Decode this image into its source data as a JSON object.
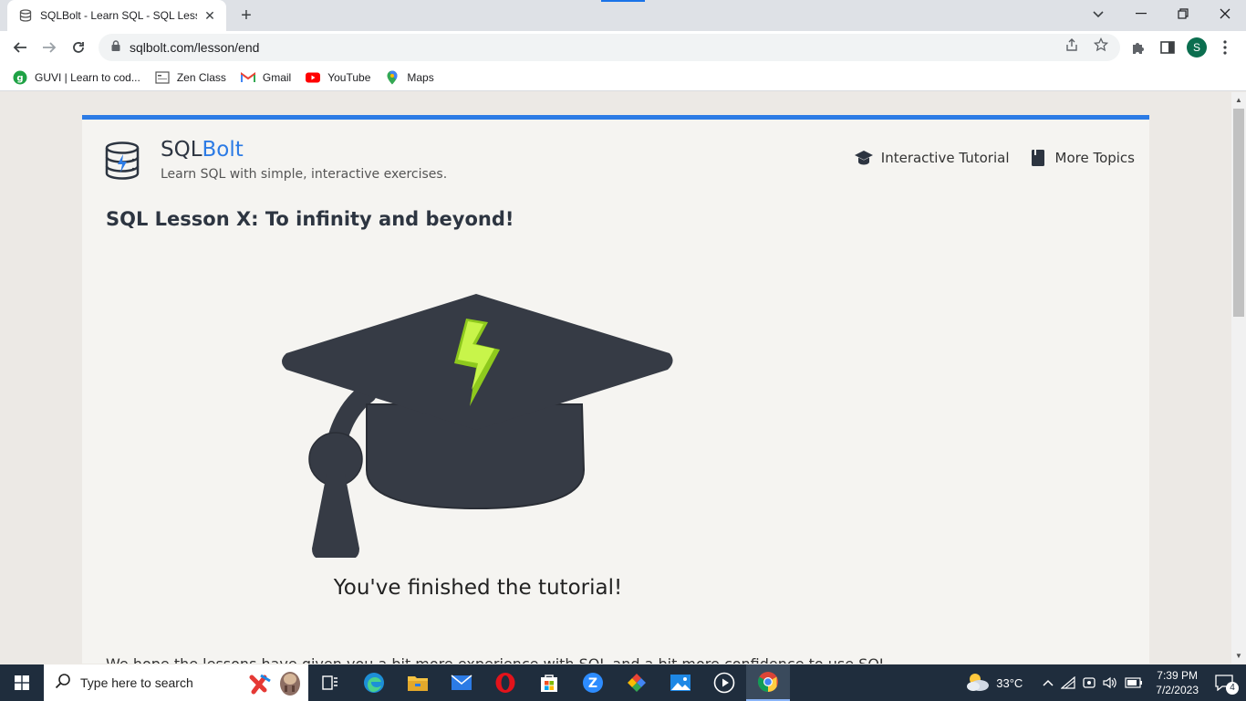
{
  "browser": {
    "tab_title": "SQLBolt - Learn SQL - SQL Lesson X: To infinity and beyond!",
    "tab_title_visible": "SQLBolt - Learn SQL - SQL Lesso",
    "url": "sqlbolt.com/lesson/end",
    "profile_initial": "S",
    "bookmarks": [
      {
        "label": "GUVI | Learn to cod...",
        "icon": "guvi-icon"
      },
      {
        "label": "Zen Class",
        "icon": "zen-class-icon"
      },
      {
        "label": "Gmail",
        "icon": "gmail-icon"
      },
      {
        "label": "YouTube",
        "icon": "youtube-icon"
      },
      {
        "label": "Maps",
        "icon": "maps-icon"
      }
    ]
  },
  "site": {
    "brand_sql": "SQL",
    "brand_bolt": "Bolt",
    "tagline": "Learn SQL with simple, interactive exercises.",
    "nav": [
      {
        "label": "Interactive Tutorial",
        "icon": "graduation-cap-icon"
      },
      {
        "label": "More Topics",
        "icon": "book-icon"
      }
    ],
    "accent_color": "#2c7be5"
  },
  "lesson": {
    "title": "SQL Lesson X: To infinity and beyond!",
    "finished_text": "You've finished the tutorial!",
    "body_text": "We hope the lessons have given you a bit more experience with SQL and a bit more confidence to use SQL"
  },
  "taskbar": {
    "search_placeholder": "Type here to search",
    "temperature": "33°C",
    "time": "7:39 PM",
    "date": "7/2/2023",
    "notification_count": "4",
    "apps": [
      "task-view-icon",
      "edge-icon",
      "file-explorer-icon",
      "mail-icon",
      "opera-icon",
      "store-icon",
      "zoom-icon",
      "photos-icon",
      "photos-app-icon",
      "media-player-icon",
      "chrome-icon"
    ]
  }
}
